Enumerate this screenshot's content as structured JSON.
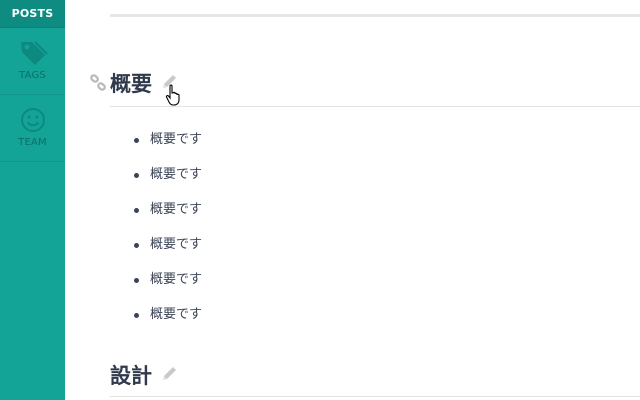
{
  "sidebar": {
    "items": [
      {
        "label": "POSTS",
        "icon": "posts-icon"
      },
      {
        "label": "TAGS",
        "icon": "tag-icon"
      },
      {
        "label": "TEAM",
        "icon": "smiley-icon"
      }
    ]
  },
  "sections": [
    {
      "title": "概要",
      "items": [
        "概要です",
        "概要です",
        "概要です",
        "概要です",
        "概要です",
        "概要です"
      ]
    },
    {
      "title": "設計"
    }
  ],
  "colors": {
    "sidebar_bg": "#13a397",
    "sidebar_active": "#0f8c82",
    "heading_text": "#303a4c"
  }
}
